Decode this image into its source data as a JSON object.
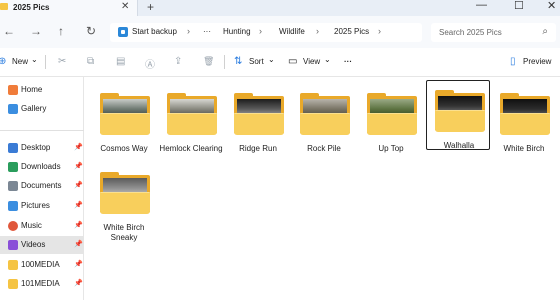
{
  "window": {
    "tab_title": "2025 Pics",
    "tab_close_glyph": "✕",
    "new_tab_glyph": "+",
    "minimize_glyph": "—",
    "maximize_glyph": "☐",
    "close_glyph": "✕"
  },
  "nav": {
    "back_glyph": "←",
    "forward_glyph": "→",
    "up_glyph": "↑",
    "refresh_glyph": "↻"
  },
  "address": {
    "root": "Start backup",
    "more": "···",
    "separator": "›",
    "crumbs": [
      "Hunting",
      "Wildlife",
      "2025 Pics"
    ]
  },
  "search": {
    "placeholder": "Search 2025 Pics",
    "icon": "⌕"
  },
  "toolbar": {
    "new_label": "New",
    "new_icon": "⊕",
    "sort_label": "Sort",
    "sort_icon": "⇅",
    "view_label": "View",
    "view_icon": "▭",
    "dropdown_glyph": "⌄",
    "more_glyph": "···",
    "preview_label": "Preview",
    "preview_icon": "▯",
    "cut_icon": "✂",
    "copy_icon": "⧉",
    "paste_icon": "▤",
    "rename_icon": "Ⓐ",
    "share_icon": "⇪",
    "delete_icon": "🗑"
  },
  "sidebar": {
    "pin_glyph": "📌",
    "items": [
      {
        "label": "Home",
        "icon": "home-icon",
        "color": "#f07c3a",
        "pinned": false
      },
      {
        "label": "Gallery",
        "icon": "gallery-icon",
        "color": "#3b8ee0",
        "pinned": false
      },
      {
        "label": "Desktop",
        "icon": "desktop-icon",
        "color": "#3a7bd5",
        "pinned": true
      },
      {
        "label": "Downloads",
        "icon": "downloads-icon",
        "color": "#2a9d5c",
        "pinned": true
      },
      {
        "label": "Documents",
        "icon": "documents-icon",
        "color": "#7b8794",
        "pinned": true
      },
      {
        "label": "Pictures",
        "icon": "pictures-icon",
        "color": "#3b8ee0",
        "pinned": true
      },
      {
        "label": "Music",
        "icon": "music-icon",
        "color": "#e0573b",
        "pinned": true
      },
      {
        "label": "Videos",
        "icon": "videos-icon",
        "color": "#8a4fd8",
        "pinned": true,
        "selected": true
      },
      {
        "label": "100MEDIA",
        "icon": "folder-icon",
        "color": "#f5c443",
        "pinned": true
      },
      {
        "label": "101MEDIA",
        "icon": "folder-icon",
        "color": "#f5c443",
        "pinned": true
      }
    ]
  },
  "folders": [
    {
      "name": "Cosmos Way",
      "thumb": [
        "#c9ccc9",
        "#6f7b73",
        "#3a443c"
      ]
    },
    {
      "name": "Hemlock Clearing",
      "thumb": [
        "#d7d7d2",
        "#8a8a80",
        "#4a4a42"
      ]
    },
    {
      "name": "Ridge Run",
      "thumb": [
        "#1d1d1d",
        "#5a5a5a",
        "#a9a9a9"
      ]
    },
    {
      "name": "Rock Pile",
      "thumb": [
        "#b8b4ab",
        "#7a7566",
        "#4e4a3e"
      ]
    },
    {
      "name": "Up Top",
      "thumb": [
        "#9aaa86",
        "#5e7442",
        "#34461f"
      ]
    },
    {
      "name": "Walhalla",
      "thumb": [
        "#111111",
        "#333333",
        "#777777"
      ],
      "selected": true
    },
    {
      "name": "White Birch",
      "thumb": [
        "#101010",
        "#2c2c2c",
        "#6a6a6a"
      ]
    },
    {
      "name": "White Birch Sneaky",
      "thumb": [
        "#5a5a5a",
        "#8f8f8f",
        "#c4c4c4"
      ]
    }
  ]
}
